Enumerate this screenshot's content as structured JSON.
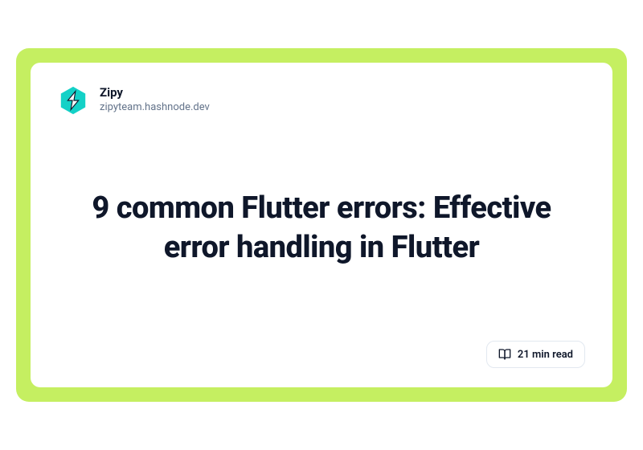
{
  "author": {
    "name": "Zipy",
    "url": "zipyteam.hashnode.dev"
  },
  "title": "9 common Flutter errors: Effective error handling in Flutter",
  "read_time": "21 min read",
  "colors": {
    "frame": "#c5ef61",
    "card": "#ffffff",
    "text_primary": "#0f172a",
    "text_secondary": "#64748b",
    "logo_teal": "#14d1c7",
    "logo_dark": "#0f172a"
  }
}
